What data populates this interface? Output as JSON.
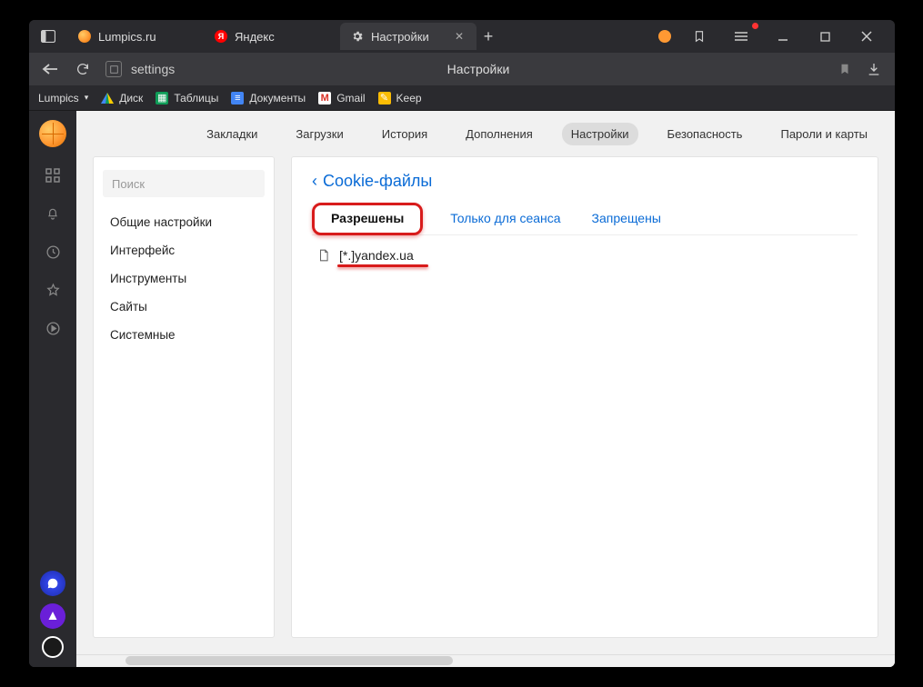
{
  "window": {
    "tabs": [
      {
        "title": "Lumpics.ru",
        "favicon_color": "#ff9933",
        "active": false
      },
      {
        "title": "Яндекс",
        "favicon_color": "#ff0000",
        "favicon_letter": "Я",
        "active": false
      },
      {
        "title": "Настройки",
        "gear": true,
        "active": true
      }
    ]
  },
  "addressbar": {
    "url": "settings",
    "page_title": "Настройки"
  },
  "bookmarks": {
    "folder": "Lumpics",
    "items": [
      {
        "label": "Диск",
        "color": "#ffcc00",
        "tri": true
      },
      {
        "label": "Таблицы",
        "color": "#0f9d58"
      },
      {
        "label": "Документы",
        "color": "#4285f4"
      },
      {
        "label": "Gmail",
        "color": "#ffffff",
        "letter": "M",
        "letter_color": "#d93025"
      },
      {
        "label": "Keep",
        "color": "#fbbc04"
      }
    ]
  },
  "topnav": {
    "items": [
      "Закладки",
      "Загрузки",
      "История",
      "Дополнения",
      "Настройки",
      "Безопасность",
      "Пароли и карты"
    ],
    "active": "Настройки"
  },
  "left_panel": {
    "search_placeholder": "Поиск",
    "items": [
      "Общие настройки",
      "Интерфейс",
      "Инструменты",
      "Сайты",
      "Системные"
    ]
  },
  "right_panel": {
    "breadcrumb": "Cookie-файлы",
    "subtabs": {
      "items": [
        "Разрешены",
        "Только для сеанса",
        "Запрещены"
      ],
      "active": "Разрешены"
    },
    "entries": [
      {
        "domain": "[*.]yandex.ua"
      }
    ]
  }
}
